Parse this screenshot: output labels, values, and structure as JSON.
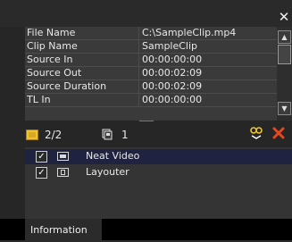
{
  "window": {
    "close_glyph": "✕"
  },
  "properties": [
    {
      "key": "File Name",
      "value": "C:\\SampleClip.mp4"
    },
    {
      "key": "Clip Name",
      "value": "SampleClip"
    },
    {
      "key": "Source In",
      "value": "00:00:00:00"
    },
    {
      "key": "Source Out",
      "value": "00:00:02:09"
    },
    {
      "key": "Source Duration",
      "value": "00:00:02:09"
    },
    {
      "key": "TL In",
      "value": "00:00:00:00"
    }
  ],
  "toolbar": {
    "clip_count": "2/2",
    "layer_count": "1"
  },
  "effects": [
    {
      "label": "Neat Video",
      "checked": true,
      "icon": "video-filter-icon",
      "selected": true
    },
    {
      "label": "Layouter",
      "checked": true,
      "icon": "layouter-icon",
      "selected": false
    }
  ],
  "tabs": {
    "information": "Information"
  },
  "colors": {
    "accent_red": "#e8461e",
    "link_icon": "#f0c232",
    "selection": "#20233f"
  }
}
